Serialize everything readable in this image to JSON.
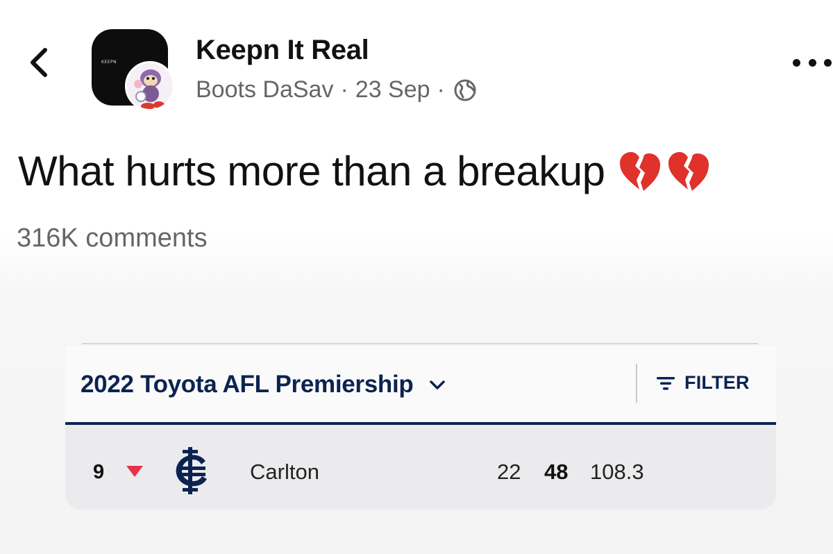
{
  "header": {
    "page_name": "Keepn It Real",
    "author": "Boots DaSav",
    "separator": "·",
    "date": "23 Sep",
    "avatar_text": "KEEPN"
  },
  "post": {
    "text": "What hurts more than a breakup",
    "emoji": [
      "broken-heart-icon",
      "broken-heart-icon"
    ],
    "comments": "316K comments"
  },
  "ladder": {
    "competition": "2022 Toyota AFL Premiership",
    "filter_label": "FILTER",
    "row": {
      "rank": "9",
      "movement": "down",
      "club": "Carlton",
      "played": "22",
      "points": "48",
      "percentage": "108.3"
    }
  },
  "colors": {
    "navy": "#0c2352",
    "down_arrow": "#e8304a",
    "heart": "#e0312b"
  }
}
